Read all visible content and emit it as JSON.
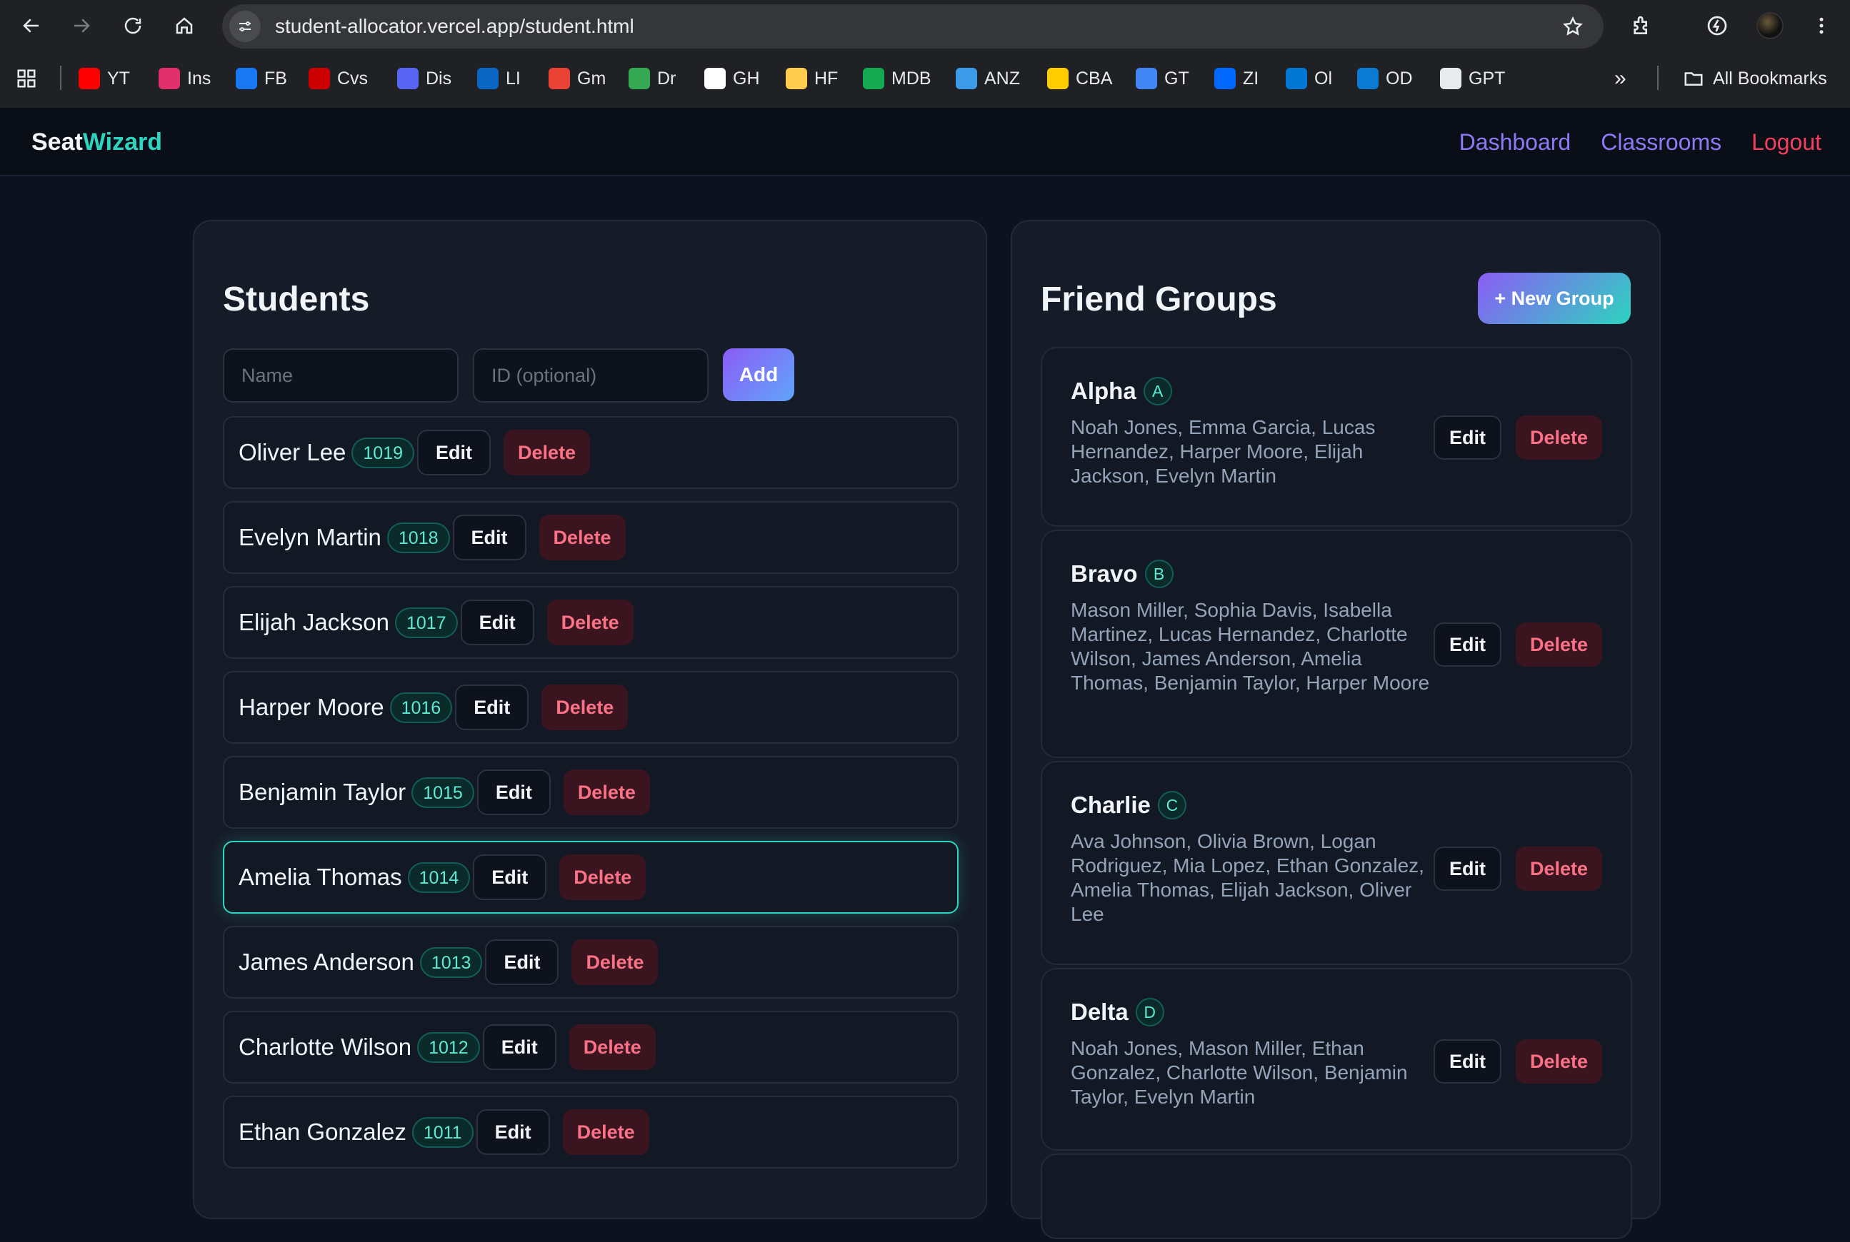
{
  "browser": {
    "url": "student-allocator.vercel.app/student.html",
    "bookmarks": [
      {
        "label": "YT",
        "icon": "youtube-icon",
        "color": "#ff0000"
      },
      {
        "label": "Ins",
        "icon": "instagram-icon",
        "color": "#e1306c"
      },
      {
        "label": "FB",
        "icon": "facebook-icon",
        "color": "#1877f2"
      },
      {
        "label": "Cvs",
        "icon": "cvs-icon",
        "color": "#cc0000"
      },
      {
        "label": "Dis",
        "icon": "discord-icon",
        "color": "#5865f2"
      },
      {
        "label": "LI",
        "icon": "linkedin-icon",
        "color": "#0a66c2"
      },
      {
        "label": "Gm",
        "icon": "gmail-icon",
        "color": "#ea4335"
      },
      {
        "label": "Dr",
        "icon": "drive-icon",
        "color": "#34a853"
      },
      {
        "label": "GH",
        "icon": "github-icon",
        "color": "#ffffff"
      },
      {
        "label": "HF",
        "icon": "huggingface-icon",
        "color": "#ffcc4d"
      },
      {
        "label": "MDB",
        "icon": "mongodb-icon",
        "color": "#13aa52"
      },
      {
        "label": "ANZ",
        "icon": "anz-icon",
        "color": "#3b9be8"
      },
      {
        "label": "CBA",
        "icon": "cba-icon",
        "color": "#ffcc00"
      },
      {
        "label": "GT",
        "icon": "google-translate-icon",
        "color": "#4285f4"
      },
      {
        "label": "ZI",
        "icon": "zalo-icon",
        "color": "#0068ff"
      },
      {
        "label": "Ol",
        "icon": "outlook-icon",
        "color": "#0078d4"
      },
      {
        "label": "OD",
        "icon": "onedrive-icon",
        "color": "#0a7ad4"
      },
      {
        "label": "GPT",
        "icon": "chatgpt-icon",
        "color": "#e8eaed"
      }
    ],
    "all_bookmarks": "All Bookmarks",
    "overflow": "»"
  },
  "app": {
    "brand_prefix": "Seat",
    "brand_accent": "Wizard",
    "nav": {
      "dashboard": "Dashboard",
      "classrooms": "Classrooms",
      "logout": "Logout"
    }
  },
  "students": {
    "title": "Students",
    "name_placeholder": "Name",
    "id_placeholder": "ID (optional)",
    "add_label": "Add",
    "edit_label": "Edit",
    "delete_label": "Delete",
    "items": [
      {
        "name": "Oliver Lee",
        "id": "1019"
      },
      {
        "name": "Evelyn Martin",
        "id": "1018"
      },
      {
        "name": "Elijah Jackson",
        "id": "1017"
      },
      {
        "name": "Harper Moore",
        "id": "1016"
      },
      {
        "name": "Benjamin Taylor",
        "id": "1015"
      },
      {
        "name": "Amelia Thomas",
        "id": "1014",
        "active": true
      },
      {
        "name": "James Anderson",
        "id": "1013"
      },
      {
        "name": "Charlotte Wilson",
        "id": "1012"
      },
      {
        "name": "Ethan Gonzalez",
        "id": "1011"
      }
    ]
  },
  "groups": {
    "title": "Friend Groups",
    "new_label": "+ New Group",
    "edit_label": "Edit",
    "delete_label": "Delete",
    "items": [
      {
        "name": "Alpha",
        "code": "A",
        "members": "Noah Jones, Emma Garcia, Lucas Hernandez, Harper Moore, Elijah Jackson, Evelyn Martin"
      },
      {
        "name": "Bravo",
        "code": "B",
        "members": "Mason Miller, Sophia Davis, Isabella Martinez, Lucas Hernandez, Charlotte Wilson, James Anderson, Amelia Thomas, Benjamin Taylor, Harper Moore"
      },
      {
        "name": "Charlie",
        "code": "C",
        "members": "Ava Johnson, Olivia Brown, Logan Rodriguez, Mia Lopez, Ethan Gonzalez, Amelia Thomas, Elijah Jackson, Oliver Lee"
      },
      {
        "name": "Delta",
        "code": "D",
        "members": "Noah Jones, Mason Miller, Ethan Gonzalez, Charlotte Wilson, Benjamin Taylor, Evelyn Martin"
      }
    ]
  }
}
